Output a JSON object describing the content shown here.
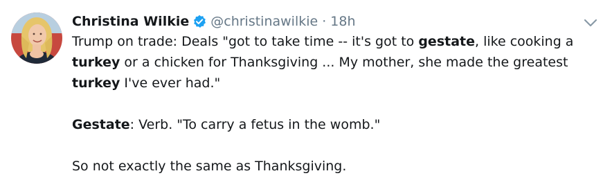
{
  "author": {
    "display_name": "Christina Wilkie",
    "handle": "@christinawilkie",
    "separator": "·",
    "time": "18h",
    "verified": true
  },
  "icons": {
    "verified": "verified-badge-icon",
    "menu": "chevron-down-icon"
  },
  "colors": {
    "verified_blue": "#1da1f2",
    "secondary_text": "#657786",
    "avatar_bg": "#c7483f",
    "hair": "#e6c56a"
  },
  "tweet": {
    "p1": {
      "t1": "Trump on trade: Deals \"got to take time -- it's got to ",
      "b1": "gestate",
      "t2": ", like cooking a ",
      "b2": "turkey",
      "t3": " or a chicken for Thanksgiving ... My mother, she made the greatest ",
      "b3": "turkey",
      "t4": " I've ever had.\""
    },
    "p2": {
      "b1": "Gestate",
      "t1": ": Verb. \"To carry a fetus in the womb.\""
    },
    "p3": {
      "t1": "So not exactly the same as Thanksgiving."
    }
  }
}
